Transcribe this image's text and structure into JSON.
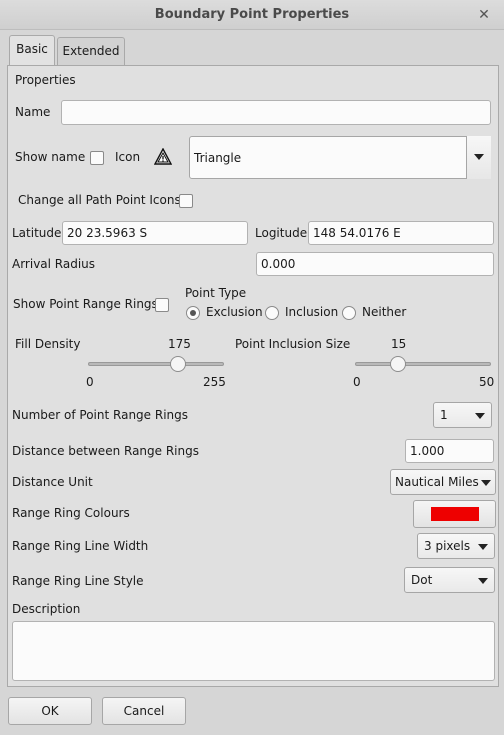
{
  "window": {
    "title": "Boundary Point Properties",
    "close_glyph": "✕"
  },
  "tabs": [
    {
      "label": "Basic",
      "active": true
    },
    {
      "label": "Extended",
      "active": false
    }
  ],
  "properties": {
    "heading": "Properties",
    "name_label": "Name",
    "name_value": "",
    "show_name_label": "Show name",
    "show_name_checked": false,
    "icon_label": "Icon",
    "icon_name": "triangle-warning-icon",
    "icon_value": "Triangle",
    "change_all_label": "Change all Path Point Icons",
    "change_all_checked": false,
    "latitude_label": "Latitude",
    "latitude_value": "20 23.5963 S",
    "longitude_label": "Logitude",
    "longitude_value": "148 54.0176 E",
    "arrival_radius_label": "Arrival Radius",
    "arrival_radius_value": "0.000"
  },
  "range_rings": {
    "show_label": "Show Point Range Rings",
    "show_checked": false,
    "point_type_label": "Point Type",
    "point_type_options": [
      "Exclusion",
      "Inclusion",
      "Neither"
    ],
    "point_type_selected": "Exclusion"
  },
  "sliders": {
    "fill_density": {
      "label": "Fill Density",
      "value": "175",
      "min": "0",
      "max": "255"
    },
    "inclusion_size": {
      "label": "Point Inclusion Size",
      "value": "15",
      "min": "0",
      "max": "50"
    }
  },
  "settings": {
    "num_rings_label": "Number of Point Range Rings",
    "num_rings_value": "1",
    "distance_label": "Distance between Range Rings",
    "distance_value": "1.000",
    "unit_label": "Distance Unit",
    "unit_value": "Nautical Miles",
    "colour_label": "Range Ring Colours",
    "colour_value": "#ee0000",
    "line_width_label": "Range Ring Line Width",
    "line_width_value": "3 pixels",
    "line_style_label": "Range Ring Line Style",
    "line_style_value": "Dot",
    "description_label": "Description",
    "description_value": ""
  },
  "buttons": {
    "ok": "OK",
    "cancel": "Cancel"
  }
}
